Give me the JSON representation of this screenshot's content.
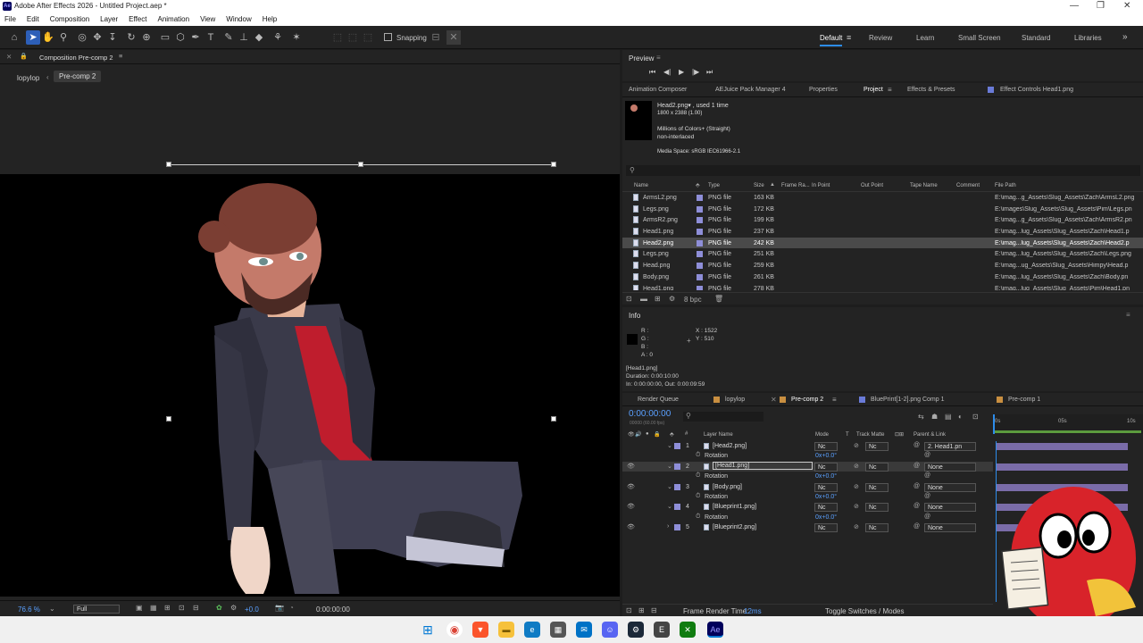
{
  "window": {
    "title": "Adobe After Effects 2026 - Untitled Project.aep *",
    "app_icon": "Ae"
  },
  "menu": [
    "File",
    "Edit",
    "Composition",
    "Layer",
    "Effect",
    "Animation",
    "View",
    "Window",
    "Help"
  ],
  "toolbar": {
    "snapping": "Snapping"
  },
  "workspaces": [
    "Default",
    "Review",
    "Learn",
    "Small Screen",
    "Standard",
    "Libraries"
  ],
  "active_workspace": "Default",
  "composition": {
    "panel_title": "Composition Pre-comp 2",
    "breadcrumbs": [
      "lopylop",
      "Pre-comp 2"
    ],
    "zoom": "76.6 %",
    "resolution": "Full",
    "exposure": "+0.0",
    "timecode": "0:00:00:00"
  },
  "preview": {
    "title": "Preview"
  },
  "project_tabs": [
    "Animation Composer",
    "AEJuice Pack Manager 4",
    "Properties",
    "Project",
    "Effects & Presets",
    "Effect Controls Head1.png"
  ],
  "active_project_tab": "Project",
  "project_info": {
    "name": "Head2.png▾ , used 1 time",
    "dims": "1800 x 2388 (1.00)",
    "colors": "Millions of Colors+ (Straight)",
    "interlace": "non-interlaced",
    "colorspace": "Media Space: sRGB IEC61966-2.1"
  },
  "project_columns": [
    "Name",
    "Type",
    "Size",
    "Frame Ra...",
    "In Point",
    "Out Point",
    "Tape Name",
    "Comment",
    "File Path"
  ],
  "project_items": [
    {
      "name": "ArmsL2.png",
      "type": "PNG file",
      "size": "163 KB",
      "path": "E:\\imag...g_Assets\\Slug_Assets\\Zach\\ArmsL2.png"
    },
    {
      "name": "Legs.png",
      "type": "PNG file",
      "size": "172 KB",
      "path": "E:\\images\\Slug_Assets\\Slug_Assets\\Pim\\Legs.pn"
    },
    {
      "name": "ArmsR2.png",
      "type": "PNG file",
      "size": "199 KB",
      "path": "E:\\imag...g_Assets\\Slug_Assets\\Zach\\ArmsR2.pn"
    },
    {
      "name": "Head1.png",
      "type": "PNG file",
      "size": "237 KB",
      "path": "E:\\imag...lug_Assets\\Slug_Assets\\Zach\\Head1.p"
    },
    {
      "name": "Head2.png",
      "type": "PNG file",
      "size": "242 KB",
      "path": "E:\\imag...lug_Assets\\Slug_Assets\\Zach\\Head2.p",
      "selected": true
    },
    {
      "name": "Legs.png",
      "type": "PNG file",
      "size": "251 KB",
      "path": "E:\\imag...lug_Assets\\Slug_Assets\\Zach\\Legs.png"
    },
    {
      "name": "Head.png",
      "type": "PNG file",
      "size": "259 KB",
      "path": "E:\\imag...ug_Assets\\Slug_Assets\\Himpy\\Head.p"
    },
    {
      "name": "Body.png",
      "type": "PNG file",
      "size": "261 KB",
      "path": "E:\\imag...lug_Assets\\Slug_Assets\\Zach\\Body.pn"
    },
    {
      "name": "Head1.png",
      "type": "PNG file",
      "size": "278 KB",
      "path": "E:\\imag...lug_Assets\\Slug_Assets\\Pim\\Head1.pn"
    }
  ],
  "project_footer": {
    "bpc": "8 bpc"
  },
  "info": {
    "title": "Info",
    "r": "R :",
    "g": "G :",
    "b": "B :",
    "a": "A :  0",
    "x": "X : 1522",
    "y": "Y : 510",
    "layer": "[Head1.png]",
    "duration": "Duration: 0:00:10:00",
    "inout": "In: 0:00:00:00, Out: 0:00:09:59"
  },
  "timeline_tabs": [
    "Render Queue",
    "lopylop",
    "Pre-comp 2",
    "BluePrint[1-2].png Comp 1",
    "Pre-comp 1"
  ],
  "active_timeline_tab": "Pre-comp 2",
  "timeline": {
    "timecode": "0:00:00:00",
    "fps": "00000 (60.00 fps)",
    "columns": {
      "name": "Layer Name",
      "mode": "Mode",
      "t": "T",
      "trackmatte": "Track Matte",
      "parent": "Parent & Link"
    },
    "ruler": [
      "0s",
      "05s",
      "10s"
    ],
    "layers": [
      {
        "num": "1",
        "name": "[Head2.png]",
        "mode": "Nc",
        "matte": "Nc",
        "parent": "2. Head1.pn",
        "prop": "Rotation",
        "val": "0x+0.0°"
      },
      {
        "num": "2",
        "name": "[Head1.png]",
        "mode": "Nc",
        "matte": "Nc",
        "parent": "None",
        "prop": "Rotation",
        "val": "0x+0.0°",
        "selected": true
      },
      {
        "num": "3",
        "name": "[Body.png]",
        "mode": "Nc",
        "matte": "Nc",
        "parent": "None",
        "prop": "Rotation",
        "val": "0x+0.0°"
      },
      {
        "num": "4",
        "name": "[Blueprint1.png]",
        "mode": "Nc",
        "matte": "Nc",
        "parent": "None",
        "prop": "Rotation",
        "val": "0x+0.0°"
      },
      {
        "num": "5",
        "name": "[Blueprint2.png]",
        "mode": "Nc",
        "matte": "Nc",
        "parent": "None"
      }
    ],
    "frame_render": "Frame Render Time:",
    "frame_render_value": "12ms",
    "toggle": "Toggle Switches / Modes"
  }
}
